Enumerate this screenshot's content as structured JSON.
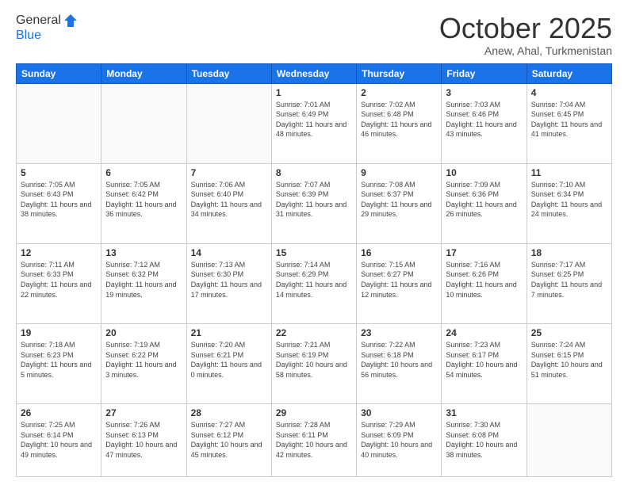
{
  "logo": {
    "line1": "General",
    "line2": "Blue"
  },
  "header": {
    "month": "October 2025",
    "location": "Anew, Ahal, Turkmenistan"
  },
  "weekdays": [
    "Sunday",
    "Monday",
    "Tuesday",
    "Wednesday",
    "Thursday",
    "Friday",
    "Saturday"
  ],
  "weeks": [
    [
      {
        "day": "",
        "info": ""
      },
      {
        "day": "",
        "info": ""
      },
      {
        "day": "",
        "info": ""
      },
      {
        "day": "1",
        "info": "Sunrise: 7:01 AM\nSunset: 6:49 PM\nDaylight: 11 hours\nand 48 minutes."
      },
      {
        "day": "2",
        "info": "Sunrise: 7:02 AM\nSunset: 6:48 PM\nDaylight: 11 hours\nand 46 minutes."
      },
      {
        "day": "3",
        "info": "Sunrise: 7:03 AM\nSunset: 6:46 PM\nDaylight: 11 hours\nand 43 minutes."
      },
      {
        "day": "4",
        "info": "Sunrise: 7:04 AM\nSunset: 6:45 PM\nDaylight: 11 hours\nand 41 minutes."
      }
    ],
    [
      {
        "day": "5",
        "info": "Sunrise: 7:05 AM\nSunset: 6:43 PM\nDaylight: 11 hours\nand 38 minutes."
      },
      {
        "day": "6",
        "info": "Sunrise: 7:05 AM\nSunset: 6:42 PM\nDaylight: 11 hours\nand 36 minutes."
      },
      {
        "day": "7",
        "info": "Sunrise: 7:06 AM\nSunset: 6:40 PM\nDaylight: 11 hours\nand 34 minutes."
      },
      {
        "day": "8",
        "info": "Sunrise: 7:07 AM\nSunset: 6:39 PM\nDaylight: 11 hours\nand 31 minutes."
      },
      {
        "day": "9",
        "info": "Sunrise: 7:08 AM\nSunset: 6:37 PM\nDaylight: 11 hours\nand 29 minutes."
      },
      {
        "day": "10",
        "info": "Sunrise: 7:09 AM\nSunset: 6:36 PM\nDaylight: 11 hours\nand 26 minutes."
      },
      {
        "day": "11",
        "info": "Sunrise: 7:10 AM\nSunset: 6:34 PM\nDaylight: 11 hours\nand 24 minutes."
      }
    ],
    [
      {
        "day": "12",
        "info": "Sunrise: 7:11 AM\nSunset: 6:33 PM\nDaylight: 11 hours\nand 22 minutes."
      },
      {
        "day": "13",
        "info": "Sunrise: 7:12 AM\nSunset: 6:32 PM\nDaylight: 11 hours\nand 19 minutes."
      },
      {
        "day": "14",
        "info": "Sunrise: 7:13 AM\nSunset: 6:30 PM\nDaylight: 11 hours\nand 17 minutes."
      },
      {
        "day": "15",
        "info": "Sunrise: 7:14 AM\nSunset: 6:29 PM\nDaylight: 11 hours\nand 14 minutes."
      },
      {
        "day": "16",
        "info": "Sunrise: 7:15 AM\nSunset: 6:27 PM\nDaylight: 11 hours\nand 12 minutes."
      },
      {
        "day": "17",
        "info": "Sunrise: 7:16 AM\nSunset: 6:26 PM\nDaylight: 11 hours\nand 10 minutes."
      },
      {
        "day": "18",
        "info": "Sunrise: 7:17 AM\nSunset: 6:25 PM\nDaylight: 11 hours\nand 7 minutes."
      }
    ],
    [
      {
        "day": "19",
        "info": "Sunrise: 7:18 AM\nSunset: 6:23 PM\nDaylight: 11 hours\nand 5 minutes."
      },
      {
        "day": "20",
        "info": "Sunrise: 7:19 AM\nSunset: 6:22 PM\nDaylight: 11 hours\nand 3 minutes."
      },
      {
        "day": "21",
        "info": "Sunrise: 7:20 AM\nSunset: 6:21 PM\nDaylight: 11 hours\nand 0 minutes."
      },
      {
        "day": "22",
        "info": "Sunrise: 7:21 AM\nSunset: 6:19 PM\nDaylight: 10 hours\nand 58 minutes."
      },
      {
        "day": "23",
        "info": "Sunrise: 7:22 AM\nSunset: 6:18 PM\nDaylight: 10 hours\nand 56 minutes."
      },
      {
        "day": "24",
        "info": "Sunrise: 7:23 AM\nSunset: 6:17 PM\nDaylight: 10 hours\nand 54 minutes."
      },
      {
        "day": "25",
        "info": "Sunrise: 7:24 AM\nSunset: 6:15 PM\nDaylight: 10 hours\nand 51 minutes."
      }
    ],
    [
      {
        "day": "26",
        "info": "Sunrise: 7:25 AM\nSunset: 6:14 PM\nDaylight: 10 hours\nand 49 minutes."
      },
      {
        "day": "27",
        "info": "Sunrise: 7:26 AM\nSunset: 6:13 PM\nDaylight: 10 hours\nand 47 minutes."
      },
      {
        "day": "28",
        "info": "Sunrise: 7:27 AM\nSunset: 6:12 PM\nDaylight: 10 hours\nand 45 minutes."
      },
      {
        "day": "29",
        "info": "Sunrise: 7:28 AM\nSunset: 6:11 PM\nDaylight: 10 hours\nand 42 minutes."
      },
      {
        "day": "30",
        "info": "Sunrise: 7:29 AM\nSunset: 6:09 PM\nDaylight: 10 hours\nand 40 minutes."
      },
      {
        "day": "31",
        "info": "Sunrise: 7:30 AM\nSunset: 6:08 PM\nDaylight: 10 hours\nand 38 minutes."
      },
      {
        "day": "",
        "info": ""
      }
    ]
  ]
}
